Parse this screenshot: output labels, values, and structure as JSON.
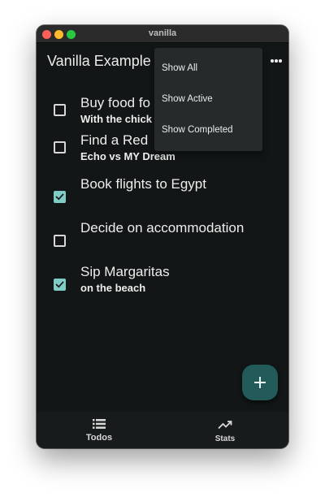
{
  "window": {
    "title": "vanilla"
  },
  "appbar": {
    "title": "Vanilla Example",
    "more_icon": "more-horizontal-icon"
  },
  "filter_menu": {
    "items": [
      {
        "label": "Show All"
      },
      {
        "label": "Show Active"
      },
      {
        "label": "Show Completed"
      }
    ]
  },
  "todos": [
    {
      "title": "Buy food fo",
      "note": "With the chick",
      "completed": false
    },
    {
      "title": "Find a Red",
      "note": "Echo vs MY Dream",
      "completed": false
    },
    {
      "title": "Book flights to Egypt",
      "note": "",
      "completed": true
    },
    {
      "title": "Decide on accommodation",
      "note": "",
      "completed": false
    },
    {
      "title": "Sip Margaritas",
      "note": "on the beach",
      "completed": true
    }
  ],
  "fab": {
    "icon": "plus-icon"
  },
  "bottom_nav": {
    "items": [
      {
        "label": "Todos",
        "icon": "list-icon"
      },
      {
        "label": "Stats",
        "icon": "trending-up-icon"
      }
    ]
  },
  "colors": {
    "background": "#121616",
    "accent": "#7fcbc6",
    "fab": "#235b5a",
    "menu": "#252a2b",
    "text": "#ececec"
  }
}
